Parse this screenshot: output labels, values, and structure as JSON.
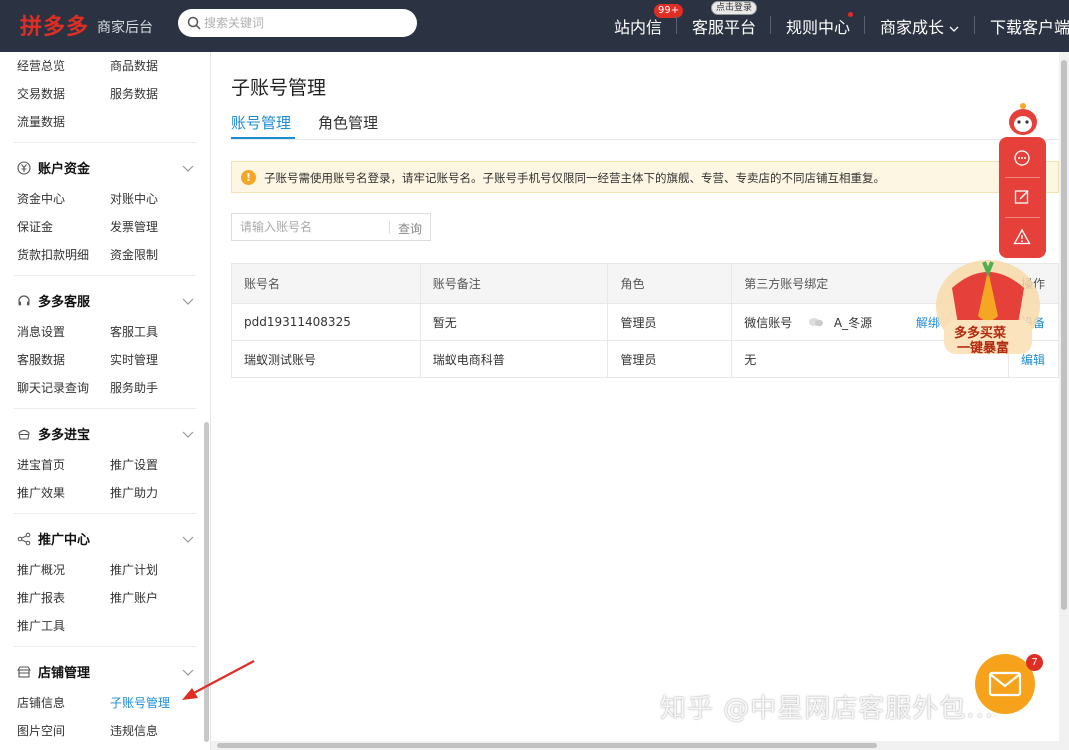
{
  "header": {
    "logo": "拼多多",
    "logo_sub": "商家后台",
    "search_placeholder": "搜索关键词",
    "nav": [
      {
        "label": "站内信",
        "badge": "99+"
      },
      {
        "label": "客服平台",
        "badge": "点击登录"
      },
      {
        "label": "规则中心"
      },
      {
        "label": "商家成长"
      },
      {
        "label": "下载客户端"
      }
    ]
  },
  "sidebar": {
    "top_links": [
      "经营总览",
      "商品数据",
      "交易数据",
      "服务数据",
      "流量数据"
    ],
    "sections": [
      {
        "title": "账户资金",
        "icon": "yen-icon",
        "links": [
          "资金中心",
          "对账中心",
          "保证金",
          "发票管理",
          "货款扣款明细",
          "资金限制"
        ]
      },
      {
        "title": "多多客服",
        "icon": "headset-icon",
        "links": [
          "消息设置",
          "客服工具",
          "客服数据",
          "实时管理",
          "聊天记录查询",
          "服务助手"
        ]
      },
      {
        "title": "多多进宝",
        "icon": "treasure-icon",
        "links": [
          "进宝首页",
          "推广设置",
          "推广效果",
          "推广助力"
        ]
      },
      {
        "title": "推广中心",
        "icon": "share-icon",
        "links": [
          "推广概况",
          "推广计划",
          "推广报表",
          "推广账户",
          "推广工具"
        ]
      },
      {
        "title": "店铺管理",
        "icon": "store-icon",
        "links": [
          "店铺信息",
          "子账号管理",
          "图片空间",
          "违规信息"
        ]
      }
    ]
  },
  "main": {
    "title": "子账号管理",
    "tabs": [
      "账号管理",
      "角色管理"
    ],
    "notice": "子账号需使用账号名登录，请牢记账号名。子账号手机号仅限同一经营主体下的旗舰、专营、专卖店的不同店铺互相重复。",
    "account_placeholder": "请输入账号名",
    "query_label": "查询",
    "table": {
      "headers": [
        "账号名",
        "账号备注",
        "角色",
        "第三方账号绑定",
        "操作"
      ],
      "rows": [
        [
          "pdd19311408325",
          "暂无",
          "管理员",
          "微信账号",
          "A_冬源",
          "解绑",
          "设备"
        ],
        [
          "瑞蚁测试账号",
          "瑞蚁电商科普",
          "管理员",
          "无",
          "编辑"
        ]
      ]
    }
  },
  "promo": {
    "line1": "多多买菜",
    "line2": "一键暴富"
  },
  "mail_badge": "7",
  "watermark": "知乎 @中星网店客服外包...",
  "colors": {
    "accent": "#1d8cd6",
    "brand": "#e02e24",
    "topbar": "#2b3342"
  }
}
